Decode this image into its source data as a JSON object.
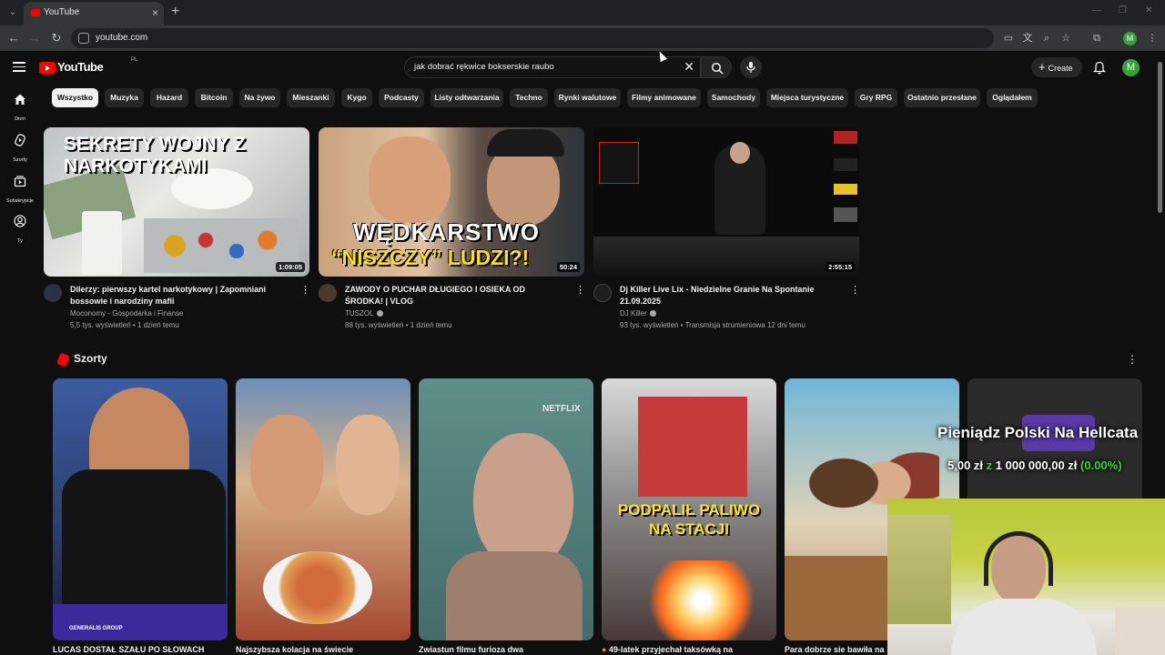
{
  "browser": {
    "tab_title": "YouTube",
    "url": "youtube.com"
  },
  "header": {
    "logo_text": "YouTube",
    "country_code": "PL",
    "search_query": "jak dobrać rękwice bokserskie raubo",
    "create_label": "Create",
    "avatar_letter": "M",
    "profile_letter": "M"
  },
  "sidebar": {
    "items": [
      {
        "label": "Dom",
        "icon": "home-icon"
      },
      {
        "label": "Szorty",
        "icon": "shorts-icon"
      },
      {
        "label": "Subskrypcje",
        "icon": "subscriptions-icon"
      },
      {
        "label": "Ty",
        "icon": "you-icon"
      }
    ]
  },
  "chips": [
    "Wszystko",
    "Muzyka",
    "Hazard",
    "Bitcoin",
    "Na żywo",
    "Mieszanki",
    "Kygo",
    "Podcasty",
    "Listy odtwarzania",
    "Techno",
    "Rynki walutowe",
    "Filmy animowane",
    "Samochody",
    "Miejsca turystyczne",
    "Gry RPG",
    "Ostatnio przesłane",
    "Oglądałem"
  ],
  "videos": [
    {
      "thumb_text": "SEKRETY WOJNY Z NARKOTYKAMI",
      "duration": "1:09:05",
      "title": "Dilerzy: pierwszy kartel narkotykowy | Zapomniani bossowie i narodziny mafii",
      "channel": "Moconomy - Gospodarka i Finanse",
      "meta": "5,5 tys. wyświetleń • 1 dzień temu"
    },
    {
      "thumb_text_top": "WĘDKARSTWO",
      "thumb_text_bottom": "“NISZCZY” LUDZI?!",
      "duration": "50:24",
      "title": "ZAWODY O PUCHAR DŁUGIEGO I OSIEKA OD ŚRODKA! | VLOG",
      "channel": "TUSZOL",
      "meta": "88 tys. wyświetleń • 1 dzień temu"
    },
    {
      "duration": "2:55:15",
      "title": "Dj Killer Live Lix - Niedzielne Granie Na Spontanie 21.09.2025",
      "channel": "DJ Killer",
      "meta": "93 tys. wyświetleń • Transmisja strumieniowa 12 dni temu"
    }
  ],
  "shorts": {
    "heading": "Szorty",
    "items": [
      {
        "title": "LUCAS DOSTAŁ SZAŁU PO SŁOWACH",
        "overlay": "GENERALIS GROUP"
      },
      {
        "title": "Najszybsza kolacja na świecie",
        "overlay": ""
      },
      {
        "title": "Zwiastun filmu furioza dwa",
        "overlay": "NETFLIX"
      },
      {
        "title": "49-latek przyjechał taksówką na",
        "overlay": "PODPALIŁ PALIWO NA STACJI"
      },
      {
        "title": "Para dobrze sie bawiła na w",
        "overlay": ""
      }
    ]
  },
  "stream_overlay": {
    "title": "Pieniądz Polski Na Hellcata",
    "balance_current": "5,00 zł",
    "balance_sep": "z",
    "balance_goal": "1 000 000,00 zł",
    "balance_pct": "(0.00%)",
    "goal_fraction": 0.0
  },
  "colors": {
    "background": "#0f0f0f",
    "youtube_red": "#ff0000",
    "chip_bg": "#272727",
    "text_secondary": "#aaaaaa",
    "overlay_green": "#39d628"
  }
}
